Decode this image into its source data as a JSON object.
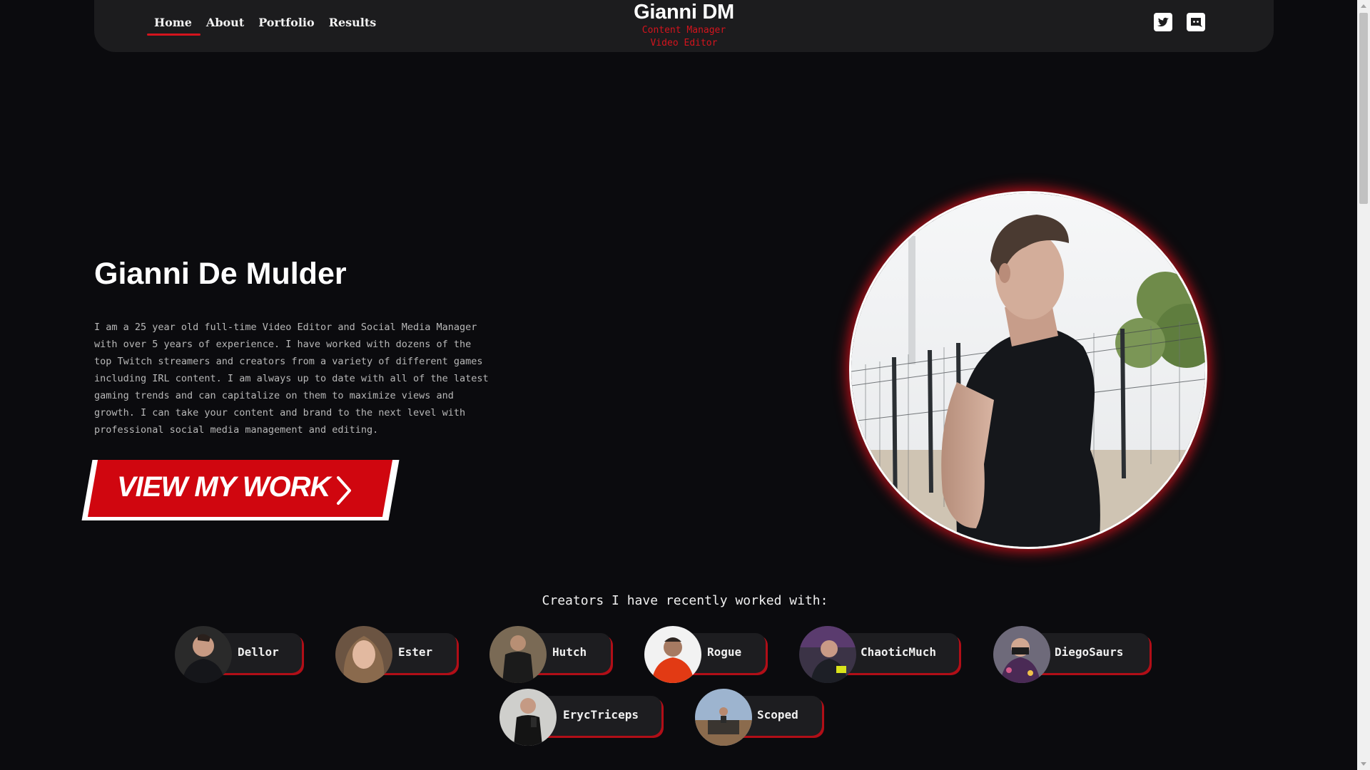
{
  "nav": {
    "items": [
      {
        "label": "Home",
        "active": true
      },
      {
        "label": "About",
        "active": false
      },
      {
        "label": "Portfolio",
        "active": false
      },
      {
        "label": "Results",
        "active": false
      }
    ]
  },
  "brand": {
    "name": "Gianni DM",
    "subtitle_1": "Content Manager",
    "subtitle_2": "Video Editor"
  },
  "socials": [
    {
      "icon": "twitter-icon"
    },
    {
      "icon": "discord-icon"
    }
  ],
  "hero": {
    "title": "Gianni De Mulder",
    "lines": [
      "I am a 25 year old full-time Video Editor and Social Media Manager",
      "with over 5 years of experience. I have worked with dozens of the",
      "top Twitch streamers and creators from a variety of different games",
      "including IRL content. I am always up to date with all of the latest",
      "gaming trends and can capitalize on them to maximize views and",
      "growth. I can take your content and brand to the next level with",
      "professional social media management and editing."
    ],
    "cta_label": "VIEW MY WORK"
  },
  "creators": {
    "title": "Creators I have recently worked with:",
    "items": [
      {
        "name": "Dellor"
      },
      {
        "name": "Ester"
      },
      {
        "name": "Hutch"
      },
      {
        "name": "Rogue"
      },
      {
        "name": "ChaoticMuch"
      },
      {
        "name": "DiegoSaurs"
      },
      {
        "name": "ErycTriceps"
      },
      {
        "name": "Scoped"
      }
    ]
  },
  "colors": {
    "accent": "#d4141d",
    "background": "#0b0b0e",
    "header": "#1c1c1e",
    "chip": "#1d1d20"
  }
}
